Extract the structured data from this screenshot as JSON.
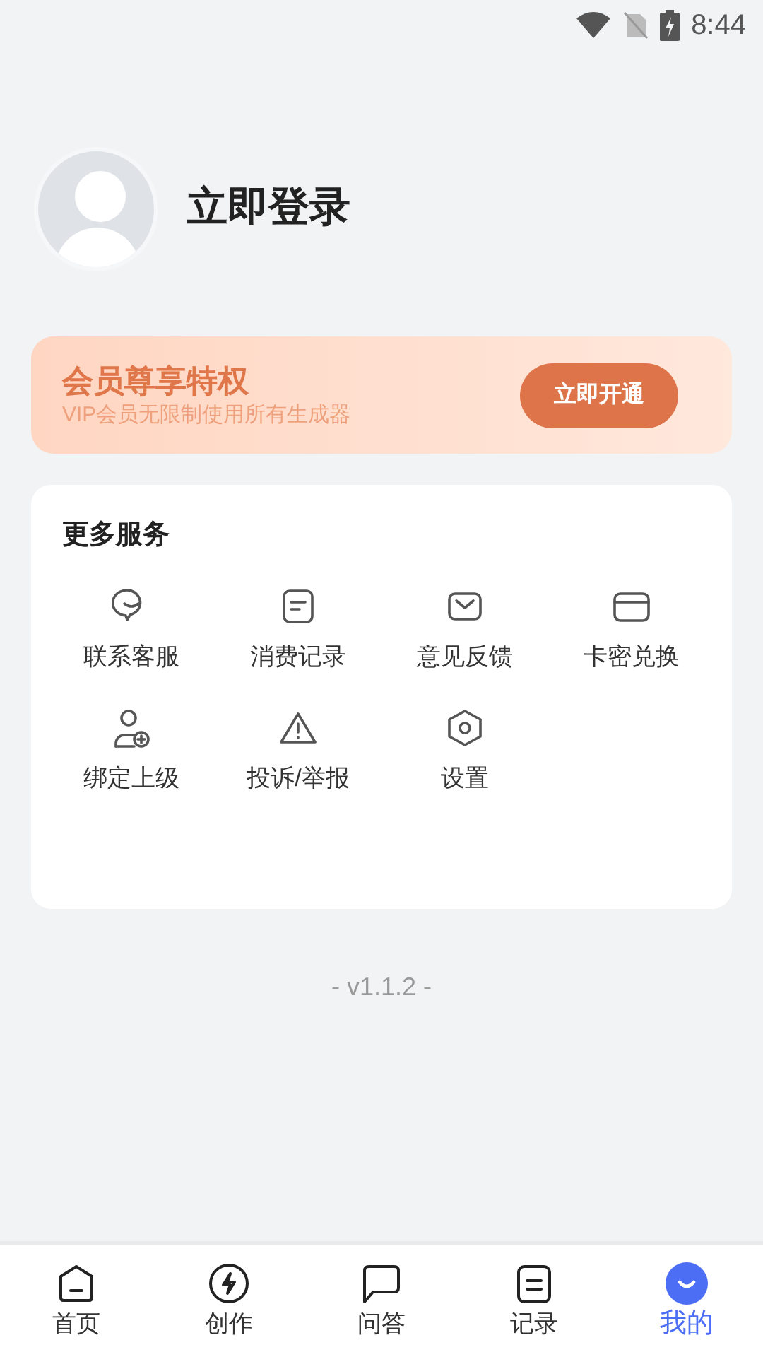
{
  "status_bar": {
    "time": "8:44"
  },
  "profile": {
    "login": "立即登录"
  },
  "vip_banner": {
    "title": "会员尊享特权",
    "subtitle": "VIP会员无限制使用所有生成器",
    "button": "立即开通"
  },
  "services": {
    "title": "更多服务",
    "items": [
      {
        "label": "联系客服"
      },
      {
        "label": "消费记录"
      },
      {
        "label": "意见反馈"
      },
      {
        "label": "卡密兑换"
      },
      {
        "label": "绑定上级"
      },
      {
        "label": "投诉/举报"
      },
      {
        "label": "设置"
      }
    ]
  },
  "version": "- v1.1.2 -",
  "tabs": [
    {
      "label": "首页",
      "selected": false
    },
    {
      "label": "创作",
      "selected": false
    },
    {
      "label": "问答",
      "selected": false
    },
    {
      "label": "记录",
      "selected": false
    },
    {
      "label": "我的",
      "selected": true
    }
  ]
}
